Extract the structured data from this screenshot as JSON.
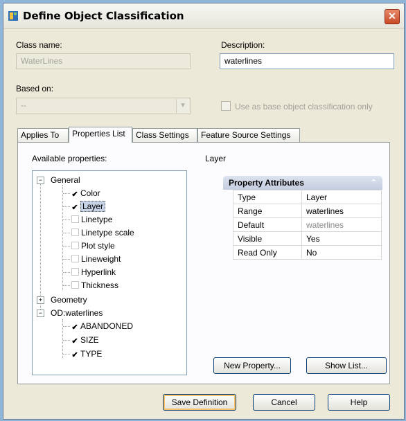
{
  "window": {
    "title": "Define Object Classification",
    "close_glyph": "✕"
  },
  "class_name": {
    "label": "Class name:",
    "value": "WaterLines"
  },
  "description": {
    "label": "Description:",
    "value": "waterlines"
  },
  "based_on": {
    "label": "Based on:",
    "value": "--"
  },
  "use_as_base": {
    "label": "Use as base object classification only",
    "checked": false
  },
  "tabs": [
    {
      "label": "Applies To"
    },
    {
      "label": "Properties List",
      "active": true
    },
    {
      "label": "Class Settings"
    },
    {
      "label": "Feature Source Settings"
    }
  ],
  "properties_tab": {
    "available_label": "Available properties:",
    "selected_property": "Layer",
    "tree": {
      "general": {
        "label": "General",
        "items": [
          {
            "label": "Color",
            "checked": true
          },
          {
            "label": "Layer",
            "checked": true,
            "selected": true
          },
          {
            "label": "Linetype",
            "checked": false
          },
          {
            "label": "Linetype scale",
            "checked": false
          },
          {
            "label": "Plot style",
            "checked": false
          },
          {
            "label": "Lineweight",
            "checked": false
          },
          {
            "label": "Hyperlink",
            "checked": false
          },
          {
            "label": "Thickness",
            "checked": false
          }
        ]
      },
      "geometry": {
        "label": "Geometry"
      },
      "od": {
        "label": "OD:waterlines",
        "items": [
          {
            "label": "ABANDONED",
            "checked": true
          },
          {
            "label": "SIZE",
            "checked": true
          },
          {
            "label": "TYPE",
            "checked": true
          }
        ]
      }
    },
    "attributes": {
      "header": "Property Attributes",
      "rows": [
        {
          "key": "Type",
          "value": "Layer"
        },
        {
          "key": "Range",
          "value": "waterlines"
        },
        {
          "key": "Default",
          "value": "waterlines"
        },
        {
          "key": "Visible",
          "value": "Yes"
        },
        {
          "key": "Read Only",
          "value": "No"
        }
      ]
    },
    "new_property_label": "New Property...",
    "show_list_label": "Show List..."
  },
  "footer": {
    "save_label": "Save Definition",
    "cancel_label": "Cancel",
    "help_label": "Help"
  },
  "colors": {
    "checkmark": "#000000",
    "header_bg": "#c4cde0",
    "default_btn_ring": "#f5c46a"
  }
}
